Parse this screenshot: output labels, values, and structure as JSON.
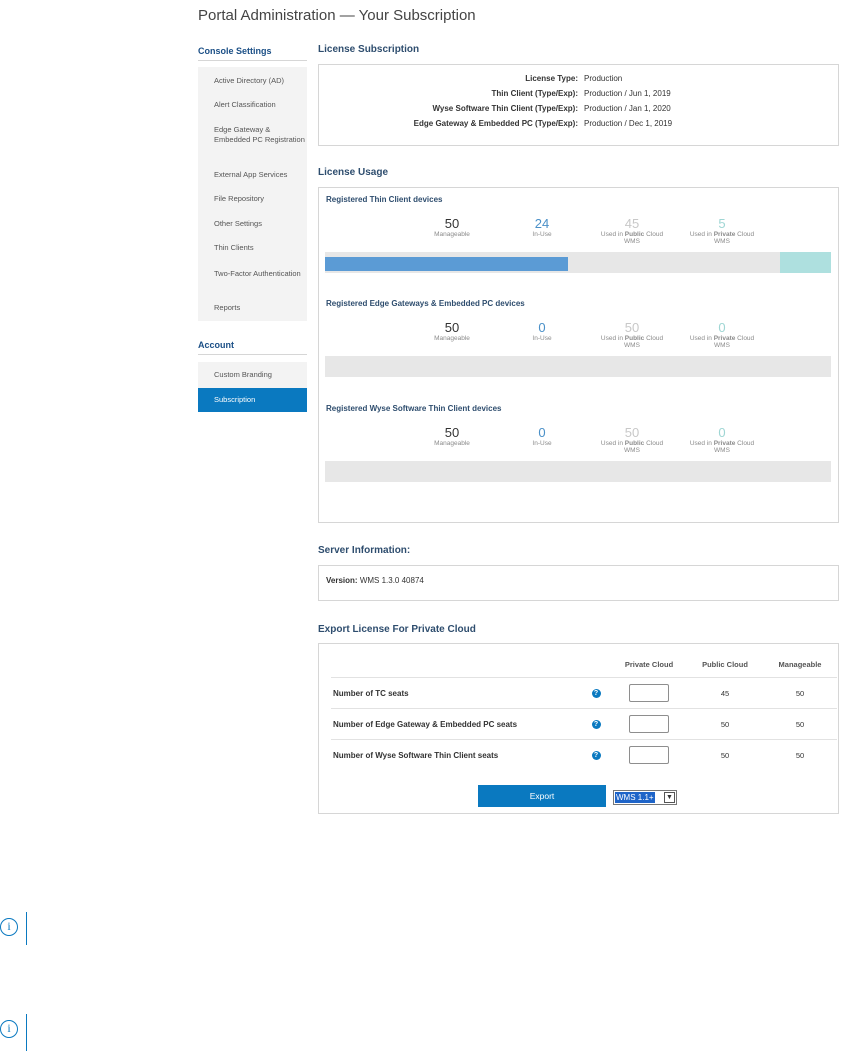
{
  "page": {
    "title": "Portal Administration — Your Subscription"
  },
  "sidebar": {
    "console_heading": "Console Settings",
    "console_items": [
      "Active Directory (AD)",
      "Alert Classification",
      "Edge Gateway & Embedded PC Registration",
      "External App Services",
      "File Repository",
      "Other Settings",
      "Thin Clients",
      "Two-Factor Authentication",
      "Reports"
    ],
    "account_heading": "Account",
    "account_items": [
      "Custom Branding",
      "Subscription"
    ],
    "active_item": "Subscription"
  },
  "license_subscription": {
    "title": "License Subscription",
    "rows": [
      {
        "label": "License Type:",
        "value": "Production"
      },
      {
        "label": "Thin Client (Type/Exp):",
        "value": "Production / Jun 1, 2019"
      },
      {
        "label": "Wyse Software Thin Client (Type/Exp):",
        "value": "Production / Jan 1, 2020"
      },
      {
        "label": "Edge Gateway & Embedded PC (Type/Exp):",
        "value": "Production / Dec 1, 2019"
      }
    ]
  },
  "license_usage": {
    "title": "License Usage",
    "groups": [
      {
        "title": "Registered Thin Client devices",
        "manageable": "50",
        "in_use": "24",
        "public": "45",
        "private": "5",
        "in_use_fraction": 0.48,
        "private_fraction": 0.1
      },
      {
        "title": "Registered Edge Gateways & Embedded PC devices",
        "manageable": "50",
        "in_use": "0",
        "public": "50",
        "private": "0",
        "in_use_fraction": 0,
        "private_fraction": 0
      },
      {
        "title": "Registered Wyse Software Thin Client devices",
        "manageable": "50",
        "in_use": "0",
        "public": "50",
        "private": "0",
        "in_use_fraction": 0,
        "private_fraction": 0
      }
    ],
    "labels": {
      "manageable": "Manageable",
      "in_use": "In-Use",
      "public_pre": "Used in ",
      "public_bold": "Public",
      "public_post": " Cloud",
      "private_pre": "Used in ",
      "private_bold": "Private",
      "private_post": " Cloud",
      "wms": "WMS"
    },
    "colors": {
      "manageable": "#333333",
      "in_use": "#4a90c8",
      "public": "#c8c8c8",
      "private": "#9fd6d4"
    }
  },
  "server_information": {
    "title": "Server Information:",
    "version_label": "Version:",
    "version_value": "WMS 1.3.0 40874"
  },
  "export_license": {
    "title": "Export License For Private Cloud",
    "columns": [
      "Private Cloud",
      "Public Cloud",
      "Manageable"
    ],
    "rows": [
      {
        "label": "Number of TC seats",
        "private": "",
        "public": "45",
        "manageable": "50"
      },
      {
        "label": "Number of Edge Gateway & Embedded PC seats",
        "private": "",
        "public": "50",
        "manageable": "50"
      },
      {
        "label": "Number of Wyse Software Thin Client seats",
        "private": "",
        "public": "50",
        "manageable": "50"
      }
    ],
    "export_button": "Export",
    "version_select": "WMS 1.1+"
  }
}
